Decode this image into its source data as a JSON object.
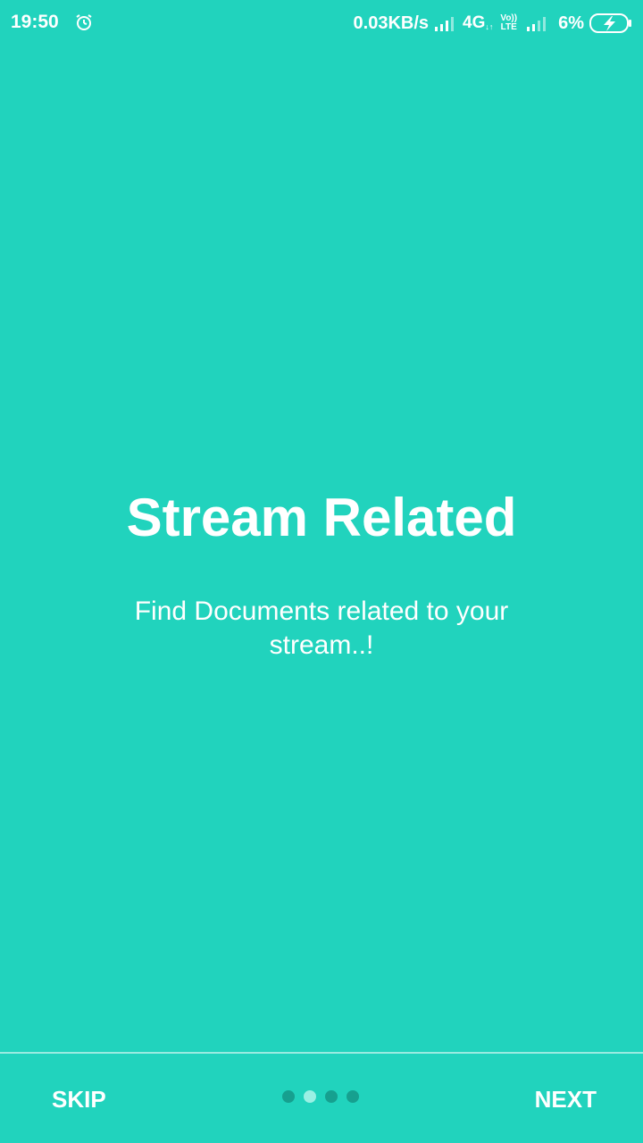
{
  "status_bar": {
    "time": "19:50",
    "network_speed": "0.03KB/s",
    "network_type": "4G",
    "network_arrows": "↓↑",
    "volte_top": "Vo))",
    "volte_bottom": "LTE",
    "battery_percent": "6%",
    "icons": [
      "alarm-icon",
      "signal-icon",
      "signal-icon-2",
      "battery-charging-icon"
    ]
  },
  "main": {
    "title": "Stream Related",
    "subtitle": "Find Documents related to your stream..!"
  },
  "bottom_bar": {
    "skip_label": "SKIP",
    "next_label": "NEXT",
    "page_indicator": {
      "total": 4,
      "active_index": 1
    }
  },
  "colors": {
    "background": "#21d3bd",
    "dot_inactive": "#16a08f",
    "dot_active": "#9af0e4",
    "text": "#ffffff"
  }
}
